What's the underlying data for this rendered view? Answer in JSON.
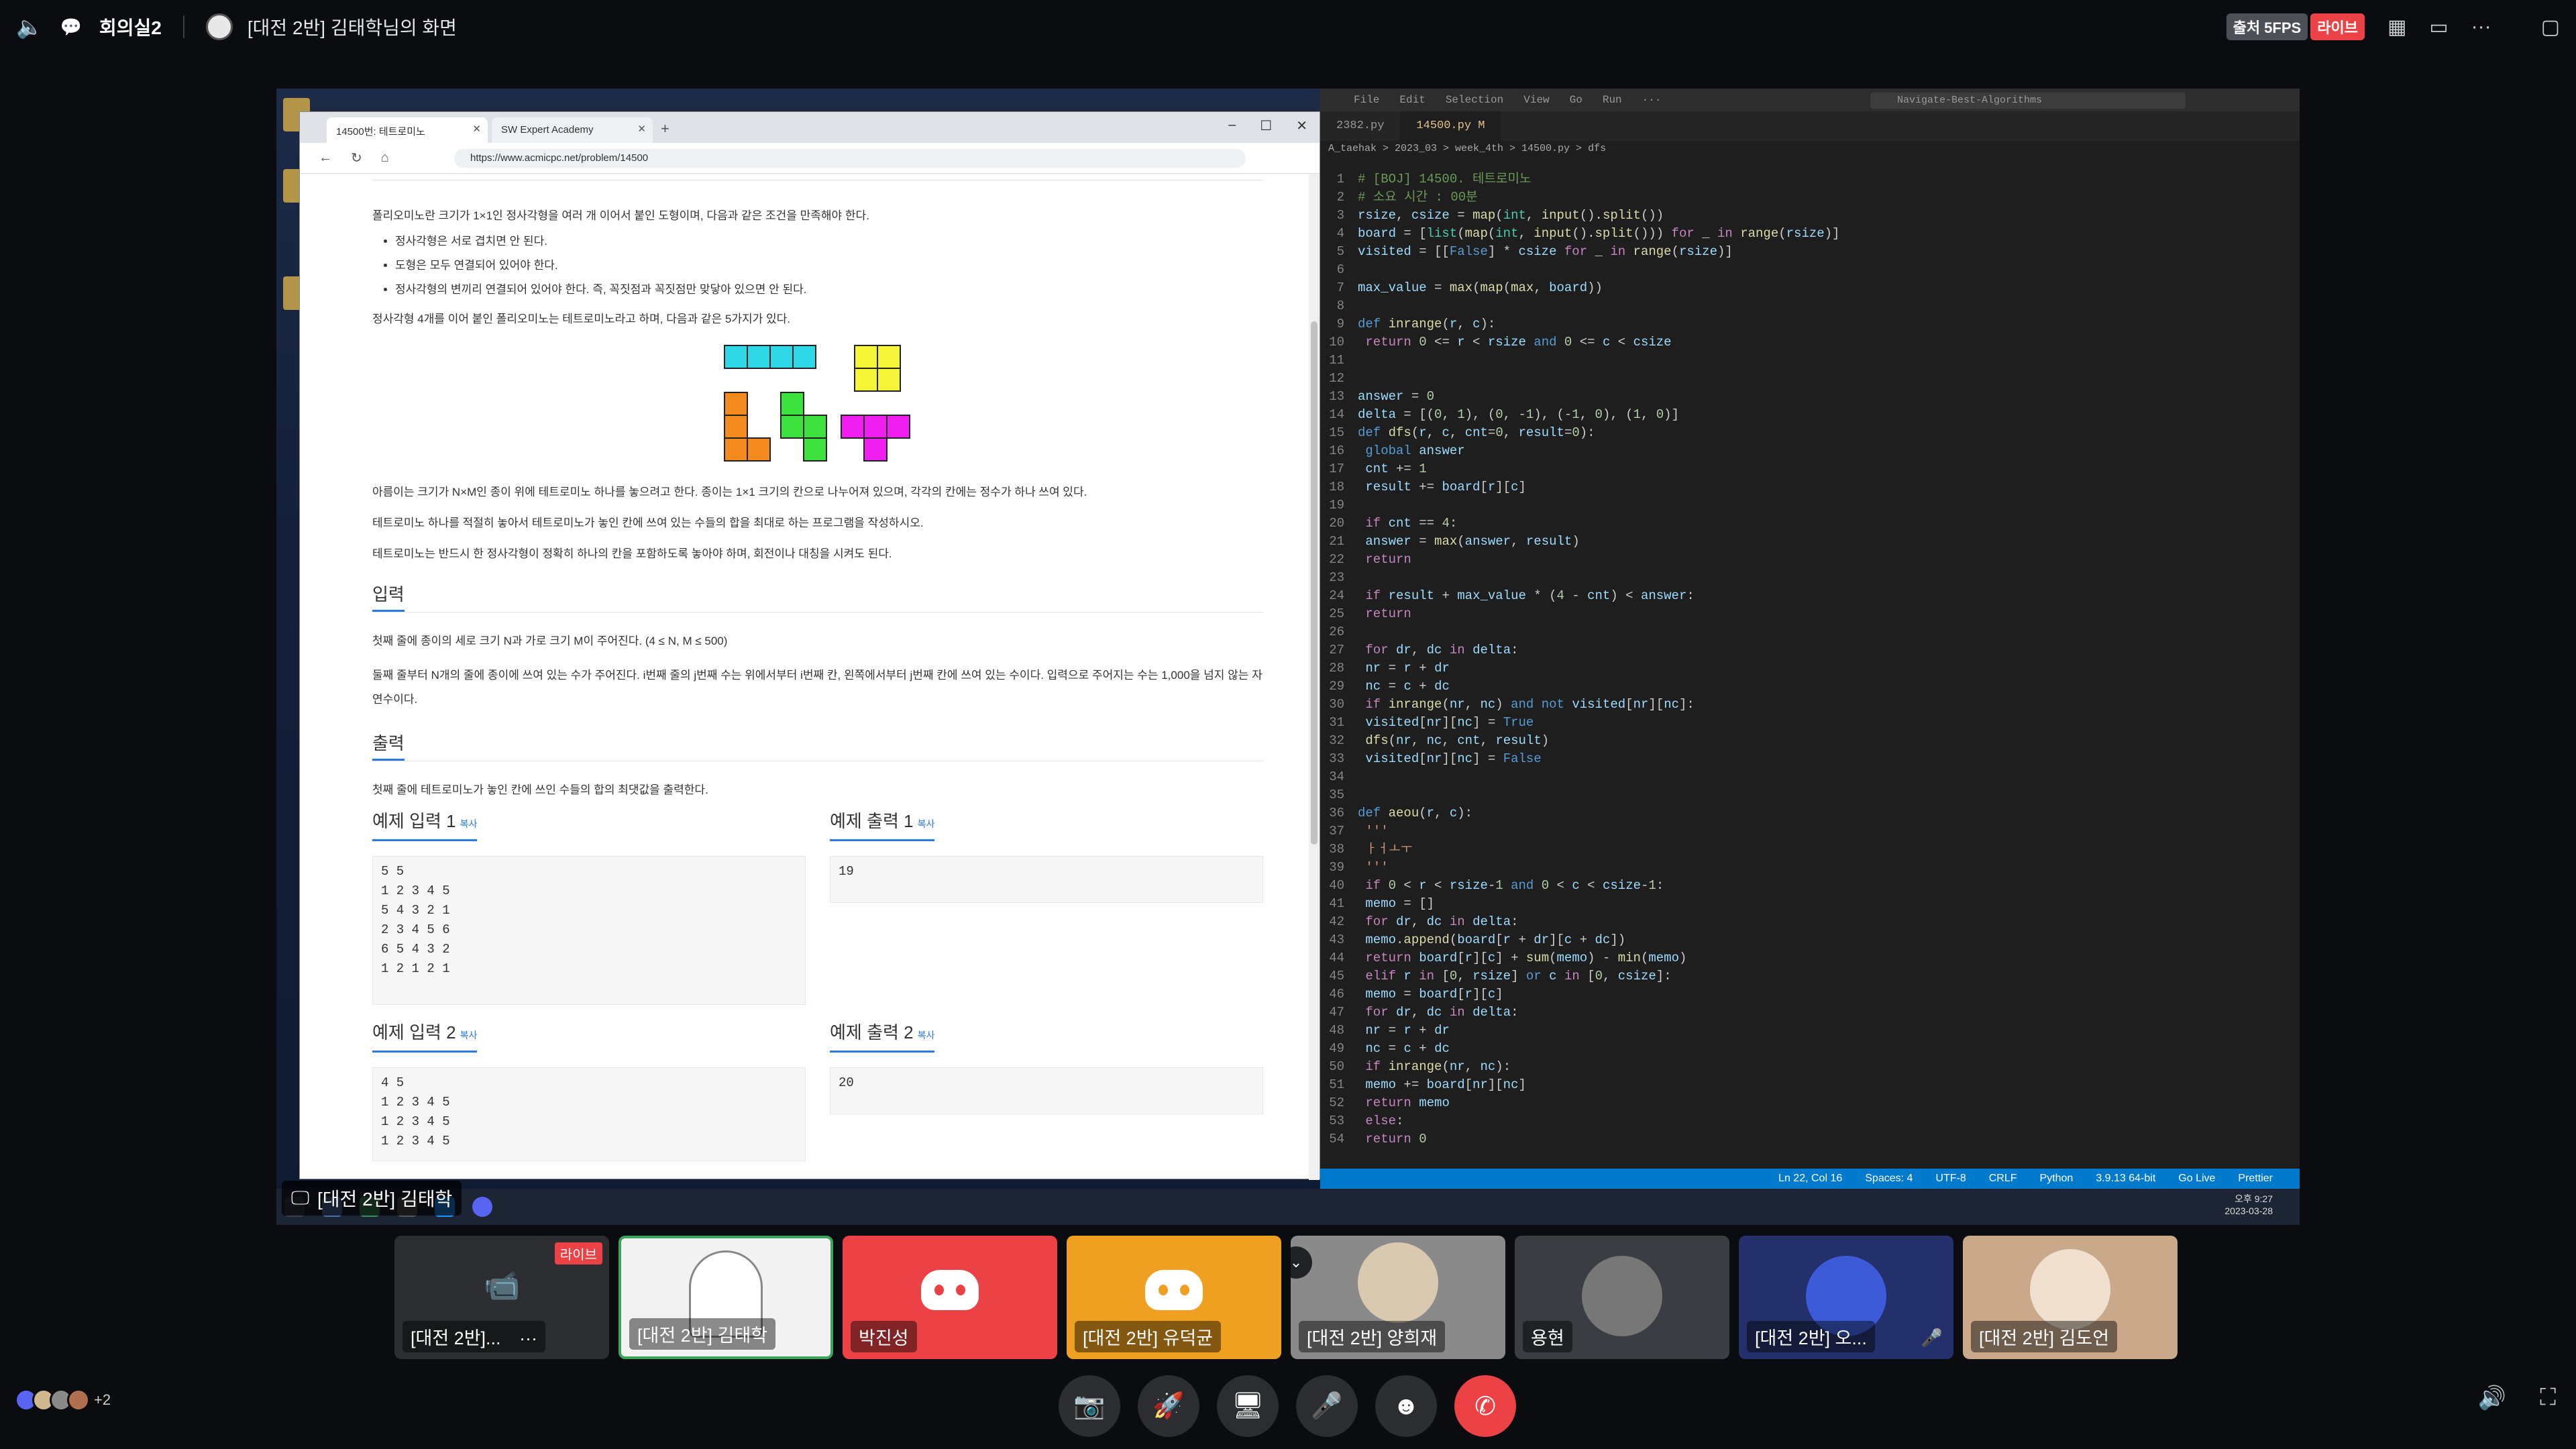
{
  "topbar": {
    "channel": "회의실2",
    "stream_title": "[대전 2반] 김태학님의 화면",
    "fps_badge": "출처 5FPS",
    "live_badge": "라이브"
  },
  "browser": {
    "tabs": [
      {
        "label": "14500번: 테트로미노"
      },
      {
        "label": "SW Expert Academy"
      }
    ],
    "url": "https://www.acmicpc.net/problem/14500",
    "intro": "폴리오미노란 크기가 1×1인 정사각형을 여러 개 이어서 붙인 도형이며, 다음과 같은 조건을 만족해야 한다.",
    "rules": [
      "정사각형은 서로 겹치면 안 된다.",
      "도형은 모두 연결되어 있어야 한다.",
      "정사각형의 변끼리 연결되어 있어야 한다. 즉, 꼭짓점과 꼭짓점만 맞닿아 있으면 안 된다."
    ],
    "tetromino_intro": "정사각형 4개를 이어 붙인 폴리오미노는 테트로미노라고 하며, 다음과 같은 5가지가 있다.",
    "para1": "아름이는 크기가 N×M인 종이 위에 테트로미노 하나를 놓으려고 한다. 종이는 1×1 크기의 칸으로 나누어져 있으며, 각각의 칸에는 정수가 하나 쓰여 있다.",
    "para2": "테트로미노 하나를 적절히 놓아서 테트로미노가 놓인 칸에 쓰여 있는 수들의 합을 최대로 하는 프로그램을 작성하시오.",
    "para3": "테트로미노는 반드시 한 정사각형이 정확히 하나의 칸을 포함하도록 놓아야 하며, 회전이나 대칭을 시켜도 된다.",
    "input_heading": "입력",
    "input_p1": "첫째 줄에 종이의 세로 크기 N과 가로 크기 M이 주어진다. (4 ≤ N, M ≤ 500)",
    "input_p2": "둘째 줄부터 N개의 줄에 종이에 쓰여 있는 수가 주어진다. i번째 줄의 j번째 수는 위에서부터 i번째 칸, 왼쪽에서부터 j번째 칸에 쓰여 있는 수이다. 입력으로 주어지는 수는 1,000을 넘지 않는 자연수이다.",
    "output_heading": "출력",
    "output_p": "첫째 줄에 테트로미노가 놓인 칸에 쓰인 수들의 합의 최댓값을 출력한다.",
    "copy_label": "복사",
    "sample_in1_title": "예제 입력 1",
    "sample_out1_title": "예제 출력 1",
    "sample_in2_title": "예제 입력 2",
    "sample_out2_title": "예제 출력 2",
    "sample_in1": "5 5\n1 2 3 4 5\n5 4 3 2 1\n2 3 4 5 6\n6 5 4 3 2\n1 2 1 2 1",
    "sample_out1": "19",
    "sample_in2": "4 5\n1 2 3 4 5\n1 2 3 4 5\n1 2 3 4 5",
    "sample_out2": "20"
  },
  "vscode": {
    "menu": [
      "File",
      "Edit",
      "Selection",
      "View",
      "Go",
      "Run",
      "···"
    ],
    "search": "Navigate-Best-Algorithms",
    "tabs": [
      {
        "label": "2382.py"
      },
      {
        "label": "14500.py M"
      }
    ],
    "breadcrumb": "A_taehak > 2023_03 > week_4th > 14500.py > dfs",
    "status": [
      "Ln 22, Col 16",
      "Spaces: 4",
      "UTF-8",
      "CRLF",
      "Python",
      "3.9.13 64-bit",
      "Go Live",
      "Prettier"
    ]
  },
  "share_label": "[대전 2반] 김태학",
  "tray": {
    "time": "오후 9:27",
    "date": "2023-03-28"
  },
  "participants": [
    {
      "name": "[대전 2반]...",
      "bg": "#2b2d31",
      "live": "라이브"
    },
    {
      "name": "[대전 2반] 김태학",
      "bg": "#f2f2f2"
    },
    {
      "name": "박진성",
      "bg": "#ed4245"
    },
    {
      "name": "[대전 2반] 유덕균",
      "bg": "#f0a020"
    },
    {
      "name": "[대전 2반] 양희재",
      "bg": "#8a8a8a"
    },
    {
      "name": "용현",
      "bg": "#3a3d42"
    },
    {
      "name": "[대전 2반] 오...",
      "bg": "#23306b"
    },
    {
      "name": "[대전 2반] 김도언",
      "bg": "#c9a98a"
    }
  ],
  "more_count": "+2",
  "colors": {
    "accent": "#2a7ae2",
    "danger": "#ed4245",
    "vscode_status": "#007acc"
  }
}
